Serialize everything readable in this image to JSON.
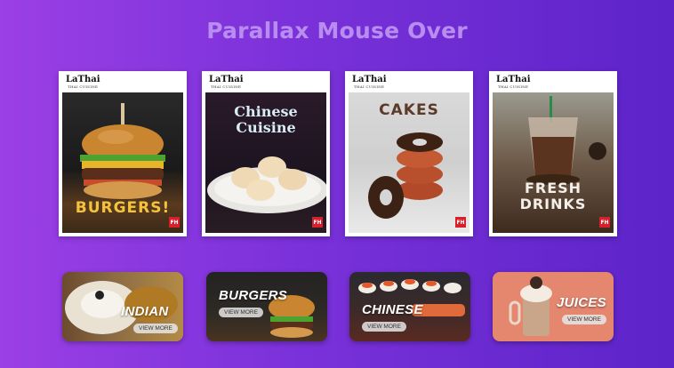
{
  "page": {
    "title": "Parallax Mouse Over"
  },
  "cards": [
    {
      "brand": "LaThai",
      "subtitle": "THAI CUISINE",
      "caption": "BURGERS!",
      "badge": "FH"
    },
    {
      "brand": "LaThai",
      "subtitle": "THAI CUISINE",
      "caption_line1": "Chinese",
      "caption_line2": "Cuisine",
      "badge": "FH"
    },
    {
      "brand": "LaThai",
      "subtitle": "THAI CUISINE",
      "caption": "CAKES",
      "badge": "FH"
    },
    {
      "brand": "LaThai",
      "subtitle": "THAI CUISINE",
      "caption_line1": "FRESH",
      "caption_line2": "DRINKS",
      "badge": "FH"
    }
  ],
  "banners": [
    {
      "label": "INDIAN",
      "button": "VIEW MORE"
    },
    {
      "label": "BURGERS",
      "button": "VIEW MORE"
    },
    {
      "label": "CHINESE",
      "button": "VIEW MORE"
    },
    {
      "label": "JUICES",
      "button": "VIEW MORE"
    }
  ],
  "colors": {
    "accent_title": "#b98df0",
    "badge_red": "#d8202c"
  }
}
